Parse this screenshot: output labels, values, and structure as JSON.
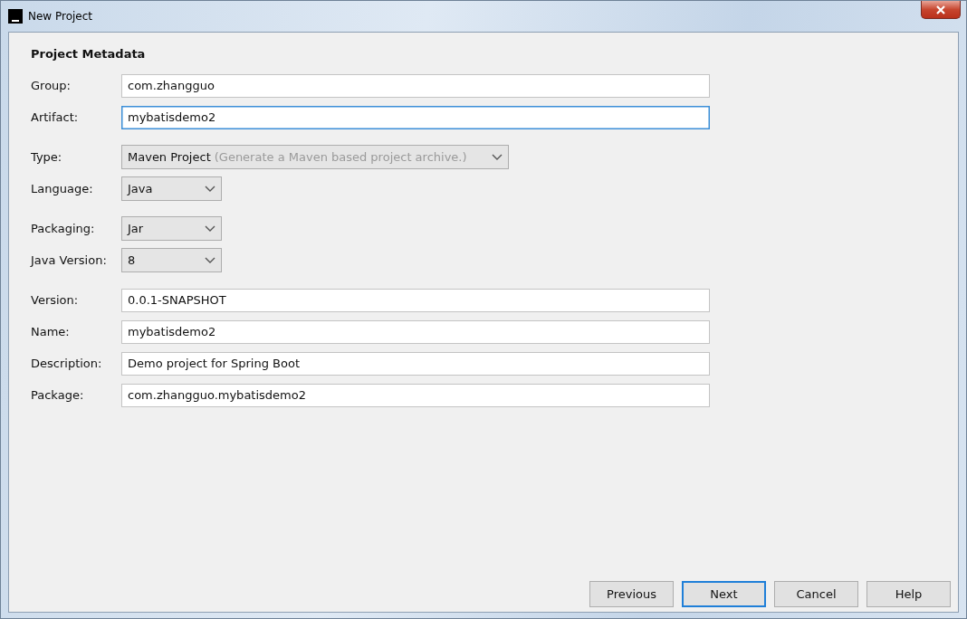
{
  "window": {
    "title": "New Project"
  },
  "heading": "Project Metadata",
  "sections": [
    [
      {
        "label": "Group:",
        "kind": "text",
        "value": "com.zhangguo",
        "focused": false
      },
      {
        "label": "Artifact:",
        "kind": "text",
        "value": "mybatisdemo2",
        "focused": true
      }
    ],
    [
      {
        "label": "Type:",
        "kind": "combo",
        "value": "Maven Project",
        "hint": "(Generate a Maven based project archive.)"
      },
      {
        "label": "Language:",
        "kind": "combo",
        "value": "Java"
      }
    ],
    [
      {
        "label": "Packaging:",
        "kind": "combo",
        "value": "Jar"
      },
      {
        "label": "Java Version:",
        "kind": "combo",
        "value": "8"
      }
    ],
    [
      {
        "label": "Version:",
        "kind": "text",
        "value": "0.0.1-SNAPSHOT",
        "focused": false
      },
      {
        "label": "Name:",
        "kind": "text",
        "value": "mybatisdemo2",
        "focused": false
      },
      {
        "label": "Description:",
        "kind": "text",
        "value": "Demo project for Spring Boot",
        "focused": false
      },
      {
        "label": "Package:",
        "kind": "text",
        "value": "com.zhangguo.mybatisdemo2",
        "focused": false
      }
    ]
  ],
  "buttons": [
    {
      "label": "Previous",
      "default": false
    },
    {
      "label": "Next",
      "default": true
    },
    {
      "label": "Cancel",
      "default": false
    },
    {
      "label": "Help",
      "default": false
    }
  ]
}
